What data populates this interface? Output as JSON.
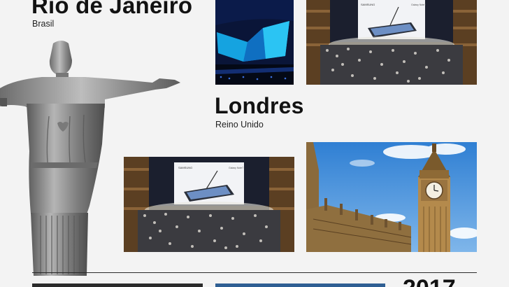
{
  "locations": [
    {
      "city": "Rio de Janeiro",
      "country": "Brasil"
    },
    {
      "city": "Londres",
      "country": "Reino Unido"
    }
  ],
  "photos": {
    "stage_blue": {
      "icon": "unpacked-stage-blue-screen"
    },
    "auditorium_top": {
      "icon": "auditorium-note-event",
      "screen_brand": "SAMSUNG",
      "screen_product": "Galaxy Note7"
    },
    "auditorium_bottom": {
      "icon": "auditorium-note-event",
      "screen_brand": "SAMSUNG",
      "screen_product": "Galaxy Note7"
    },
    "big_ben": {
      "icon": "big-ben-westminster"
    }
  },
  "statue": {
    "icon": "christ-the-redeemer-statue"
  },
  "bottom": {
    "year_peek": "2017"
  },
  "colors": {
    "background": "#f3f3f3",
    "text": "#121212",
    "divider": "#2a2a2a",
    "sky": "#4a8fd6"
  }
}
